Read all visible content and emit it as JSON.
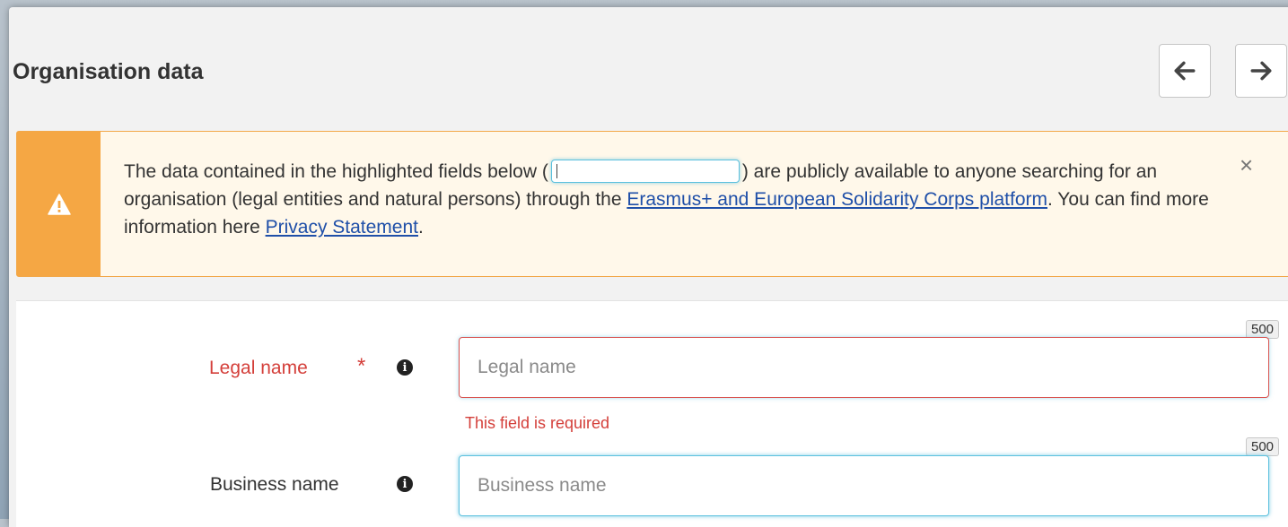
{
  "header": {
    "title": "Organisation data",
    "prev_icon": "arrow-left-icon",
    "next_icon": "arrow-right-icon"
  },
  "alert": {
    "icon": "warning-icon",
    "text_part1": "The data contained in the highlighted fields below (",
    "text_part2": ") are publicly available to anyone searching for an organisation (legal entities and natural persons) through the ",
    "link1": "Erasmus+ and European Solidarity Corps platform",
    "text_part3": ". You can find more information here ",
    "link2": "Privacy Statement",
    "text_part4": ".",
    "close_label": "×"
  },
  "form": {
    "legal_name": {
      "label": "Legal name",
      "required_marker": "*",
      "placeholder": "Legal name",
      "value": "",
      "max_length": "500",
      "error": "This field is required"
    },
    "business_name": {
      "label": "Business name",
      "placeholder": "Business name",
      "value": "",
      "max_length": "500"
    }
  },
  "colors": {
    "warning": "#f5a744",
    "error": "#d43f3a",
    "focus": "#5bc0de",
    "link": "#1f4fa8"
  }
}
